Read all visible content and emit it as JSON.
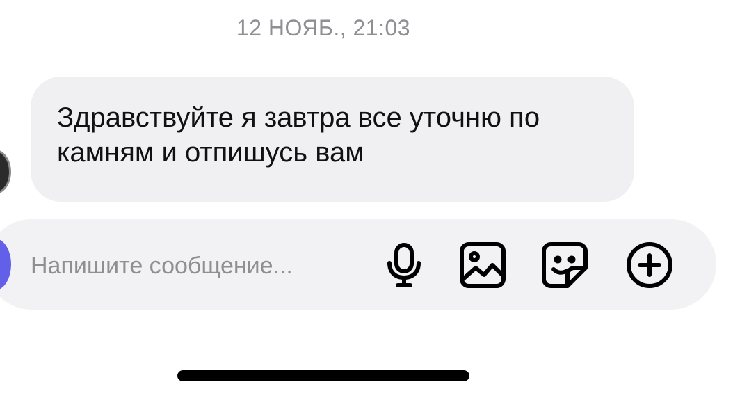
{
  "chat": {
    "timestamp": "12 НОЯБ., 21:03",
    "messages": [
      {
        "text": "Здравствуйте я завтра все уточню по камням и отпишусь вам",
        "direction": "incoming"
      }
    ]
  },
  "composer": {
    "placeholder": "Напишите сообщение...",
    "value": "",
    "icons": [
      "microphone-icon",
      "image-icon",
      "sticker-icon",
      "plus-circle-icon"
    ]
  },
  "colors": {
    "bubble_background": "#f0f0f2",
    "composer_background": "#f2f2f4",
    "avatar_accent": "#6260e8",
    "secondary_text": "#8e8e93"
  }
}
